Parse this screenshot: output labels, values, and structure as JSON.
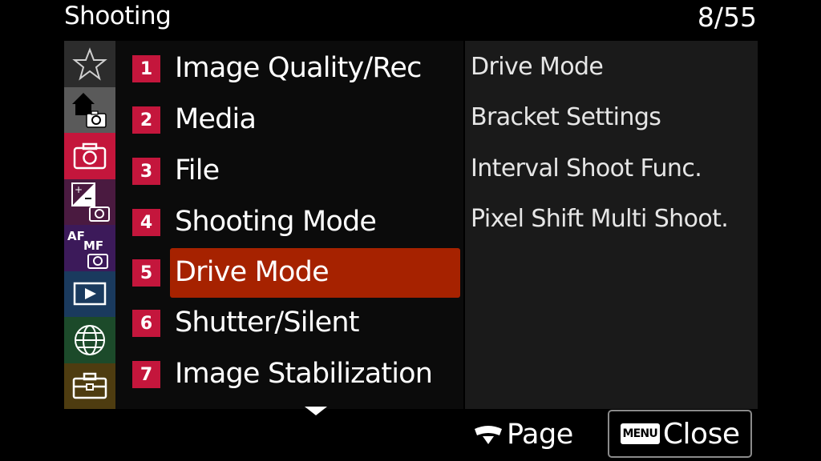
{
  "header": {
    "title": "Shooting",
    "page": "8/55"
  },
  "sidebar": {
    "tabs": [
      {
        "icon": "star-icon",
        "color": "#2c2c2c"
      },
      {
        "icon": "home-camera-icon",
        "color": "#5a5a5a"
      },
      {
        "icon": "camera-icon",
        "color": "#c4163c"
      },
      {
        "icon": "exposure-camera-icon",
        "color": "#4a1a40"
      },
      {
        "icon": "af-mf-camera-icon",
        "color": "#3c1a5a",
        "af": "AF",
        "mf": "MF"
      },
      {
        "icon": "playback-icon",
        "color": "#1a3a5e"
      },
      {
        "icon": "globe-icon",
        "color": "#1c4a2a"
      },
      {
        "icon": "toolbox-icon",
        "color": "#4e3c10"
      }
    ]
  },
  "menu": {
    "items": [
      {
        "num": "1",
        "label": "Image Quality/Rec"
      },
      {
        "num": "2",
        "label": "Media"
      },
      {
        "num": "3",
        "label": "File"
      },
      {
        "num": "4",
        "label": "Shooting Mode"
      },
      {
        "num": "5",
        "label": "Drive Mode"
      },
      {
        "num": "6",
        "label": "Shutter/Silent"
      },
      {
        "num": "7",
        "label": "Image Stabilization"
      }
    ]
  },
  "submenu": {
    "items": [
      "Drive Mode",
      "Bracket Settings",
      "Interval Shoot Func.",
      "Pixel Shift Multi Shoot."
    ]
  },
  "footer": {
    "page_label": "Page",
    "menu_badge": "MENU",
    "close_label": "Close"
  },
  "colors": {
    "highlight": "#a62200",
    "number_badge": "#c4163c"
  }
}
